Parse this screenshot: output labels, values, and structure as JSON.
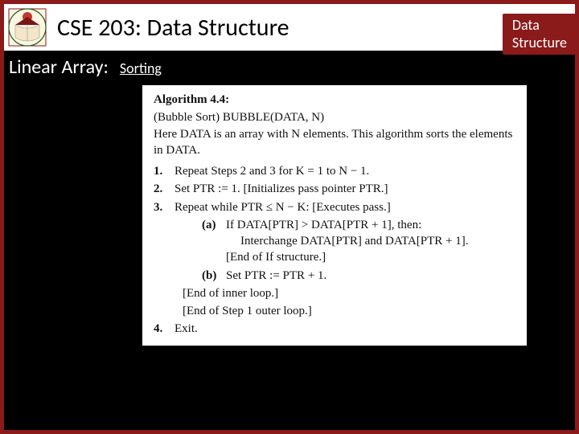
{
  "header": {
    "course_title": "CSE 203: Data Structure",
    "badge_line1": "Data",
    "badge_line2": "Structure"
  },
  "subheader": {
    "section": "Linear Array:",
    "topic": "Sorting"
  },
  "algorithm": {
    "heading": "Algorithm 4.4:",
    "intro_line1": "(Bubble Sort) BUBBLE(DATA, N)",
    "intro_line2": "Here DATA is an array with N elements. This algorithm sorts the elements in DATA.",
    "steps": [
      {
        "num": "1.",
        "text": "Repeat Steps 2 and 3 for K = 1 to N − 1."
      },
      {
        "num": "2.",
        "text": "Set PTR := 1. [Initializes pass pointer PTR.]"
      },
      {
        "num": "3.",
        "text": "Repeat while PTR ≤ N − K: [Executes pass.]"
      }
    ],
    "sub_a_label": "(a)",
    "sub_a_line1": "If DATA[PTR] > DATA[PTR + 1], then:",
    "sub_a_line2": "Interchange DATA[PTR] and DATA[PTR + 1].",
    "sub_a_end": "[End of If structure.]",
    "sub_b_label": "(b)",
    "sub_b_text": "Set PTR := PTR + 1.",
    "end_inner": "[End of inner loop.]",
    "end_outer": "[End of Step 1 outer loop.]",
    "step4_num": "4.",
    "step4_text": "Exit."
  }
}
